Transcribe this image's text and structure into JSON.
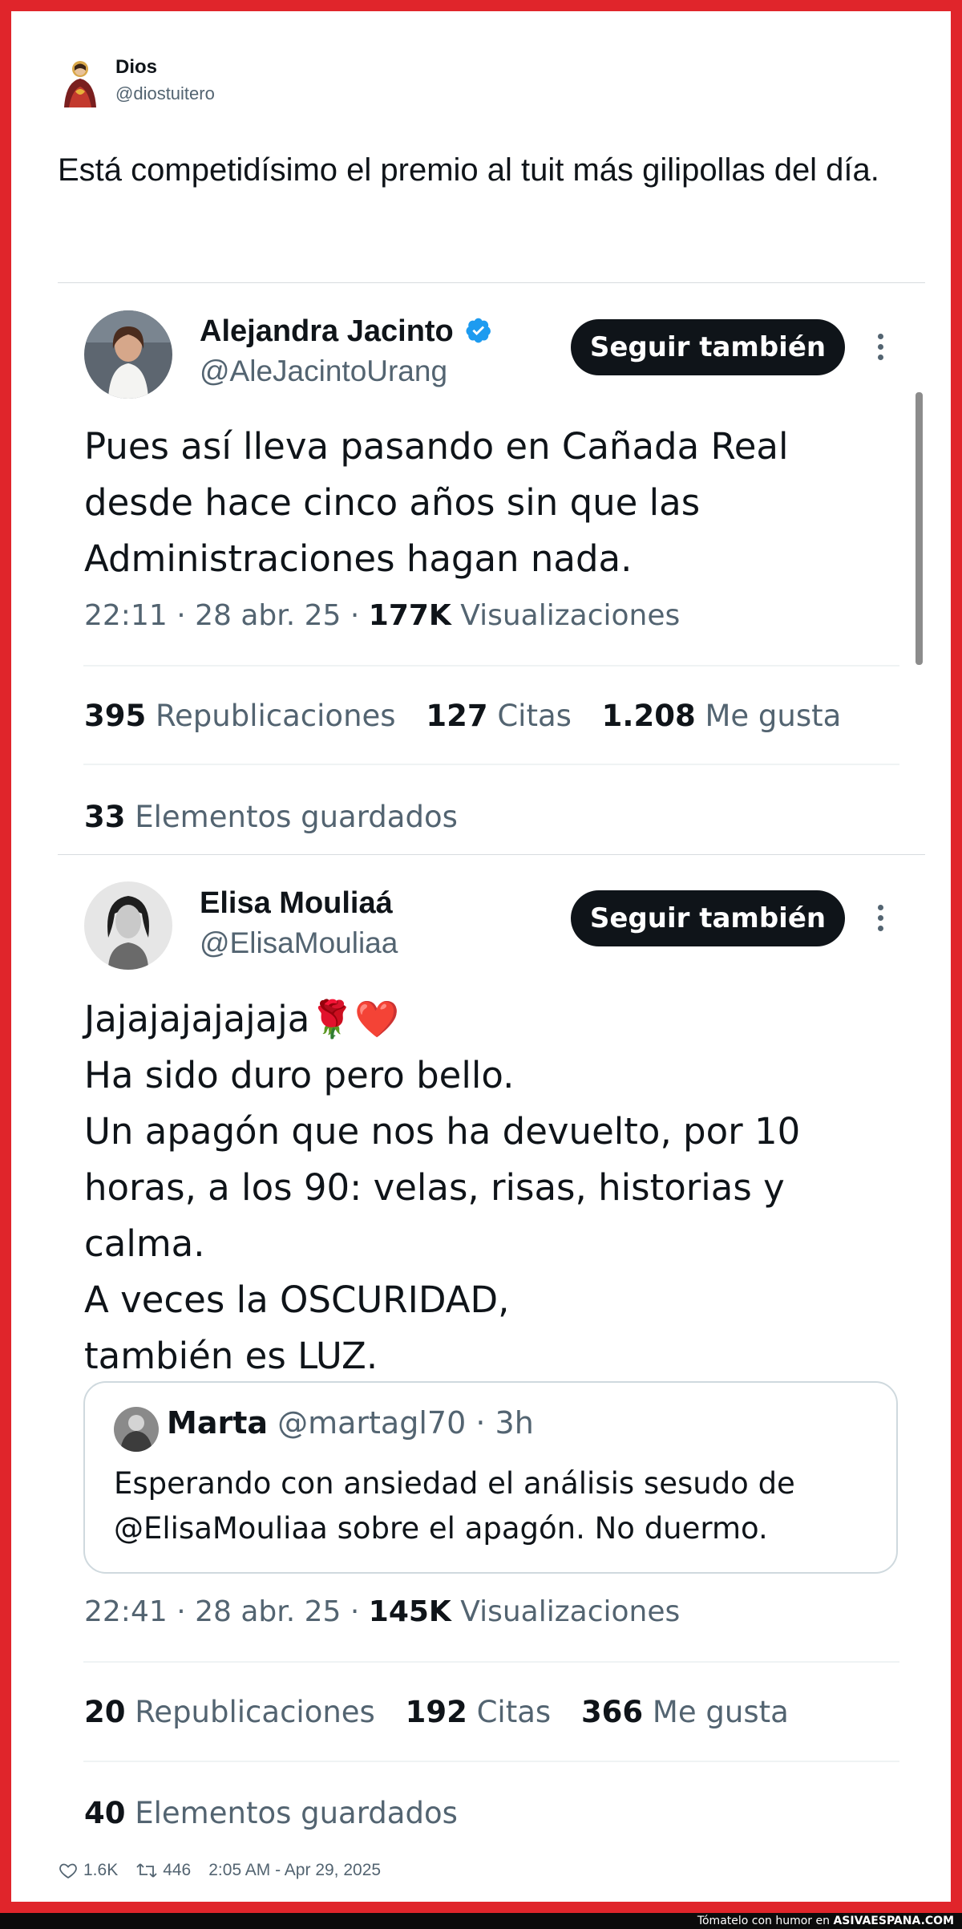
{
  "outer": {
    "name": "Dios",
    "handle": "@diostuitero",
    "text": "Está competidísimo el premio al tuit más gilipollas del día.",
    "likes": "1.6K",
    "retweets": "446",
    "timestamp": "2:05 AM - Apr 29, 2025"
  },
  "tweet1": {
    "name": "Alejandra Jacinto",
    "verified": true,
    "handle": "@AleJacintoUrang",
    "follow_label": "Seguir también",
    "text": "Pues así lleva pasando en Cañada Real desde hace cinco años sin que las Administraciones hagan nada.",
    "time": "22:11 · 28 abr. 25 · ",
    "views_count": "177K",
    "views_label": " Visualizaciones",
    "reposts_count": "395",
    "reposts_label": " Republicaciones",
    "quotes_count": "127",
    "quotes_label": " Citas",
    "likes_count": "1.208",
    "likes_label": " Me gusta",
    "saved_count": "33",
    "saved_label": " Elementos guardados"
  },
  "tweet2": {
    "name": "Elisa Mouliaá",
    "handle": "@ElisaMouliaa",
    "follow_label": "Seguir también",
    "lines": [
      "Jajajajajajaja🌹❤️",
      "Ha sido duro pero bello.",
      "Un apagón que nos ha devuelto, por 10 horas, a los 90: velas, risas, historias y calma.",
      "A veces la OSCURIDAD,",
      "también es LUZ."
    ],
    "quote": {
      "name": "Marta",
      "handle": "@martagl70",
      "time": "· 3h",
      "text": "Esperando con ansiedad el análisis sesudo de @ElisaMouliaa sobre el apagón. No duermo."
    },
    "time": "22:41 · 28 abr. 25 · ",
    "views_count": "145K",
    "views_label": " Visualizaciones",
    "reposts_count": "20",
    "reposts_label": " Republicaciones",
    "quotes_count": "192",
    "quotes_label": " Citas",
    "likes_count": "366",
    "likes_label": " Me gusta",
    "saved_count": "40",
    "saved_label": " Elementos guardados"
  },
  "footer": {
    "text": "Tómatelo con humor en ",
    "brand": "ASIVAESPANA.COM"
  },
  "colors": {
    "frame": "#e0252b",
    "text": "#0f1419",
    "muted": "#536471",
    "verified": "#1d9bf0"
  }
}
